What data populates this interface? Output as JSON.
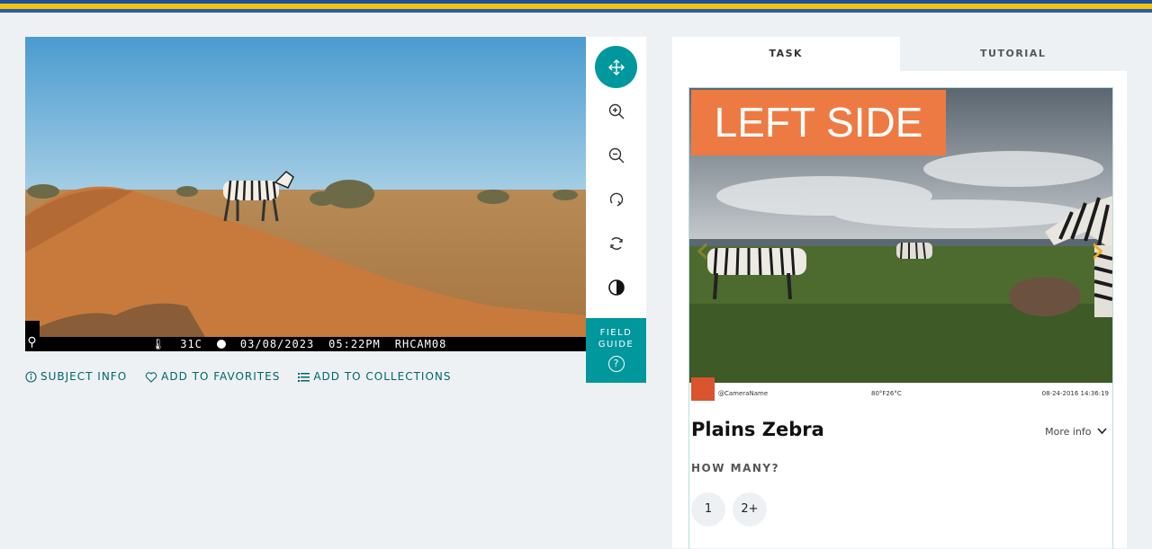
{
  "subject_image": {
    "camera_overlay": {
      "temperature": "31C",
      "date": "03/08/2023",
      "time": "05:22PM",
      "camera_id": "RHCAM08"
    }
  },
  "toolbar": {
    "tools": [
      "move-icon",
      "zoom-in-icon",
      "zoom-out-icon",
      "rotate-icon",
      "reset-icon",
      "invert-icon"
    ],
    "field_guide_label": "FIELD GUIDE",
    "field_guide_help": "?"
  },
  "meta_links": {
    "subject_info": "SUBJECT INFO",
    "add_to_favorites": "ADD TO FAVORITES",
    "add_to_collections": "ADD TO COLLECTIONS"
  },
  "panel": {
    "tabs": [
      {
        "label": "TASK"
      },
      {
        "label": "TUTORIAL"
      }
    ],
    "species_card": {
      "banner": "LEFT SIDE",
      "image_strip": {
        "camera_name": "@CameraName",
        "temperature": "80°F26°C",
        "datetime": "08-24-2016 14:36:19"
      },
      "species_name": "Plains Zebra",
      "more_info": "More info",
      "how_many_label": "HOW MANY?",
      "count_options": [
        "1",
        "2+"
      ]
    }
  },
  "colors": {
    "accent": "#00979d",
    "banner": "#ee7a43",
    "nav_arrow": "#f0b020",
    "top_stripe_blue": "#1f4e9c",
    "top_stripe_yellow": "#f4c20d"
  }
}
